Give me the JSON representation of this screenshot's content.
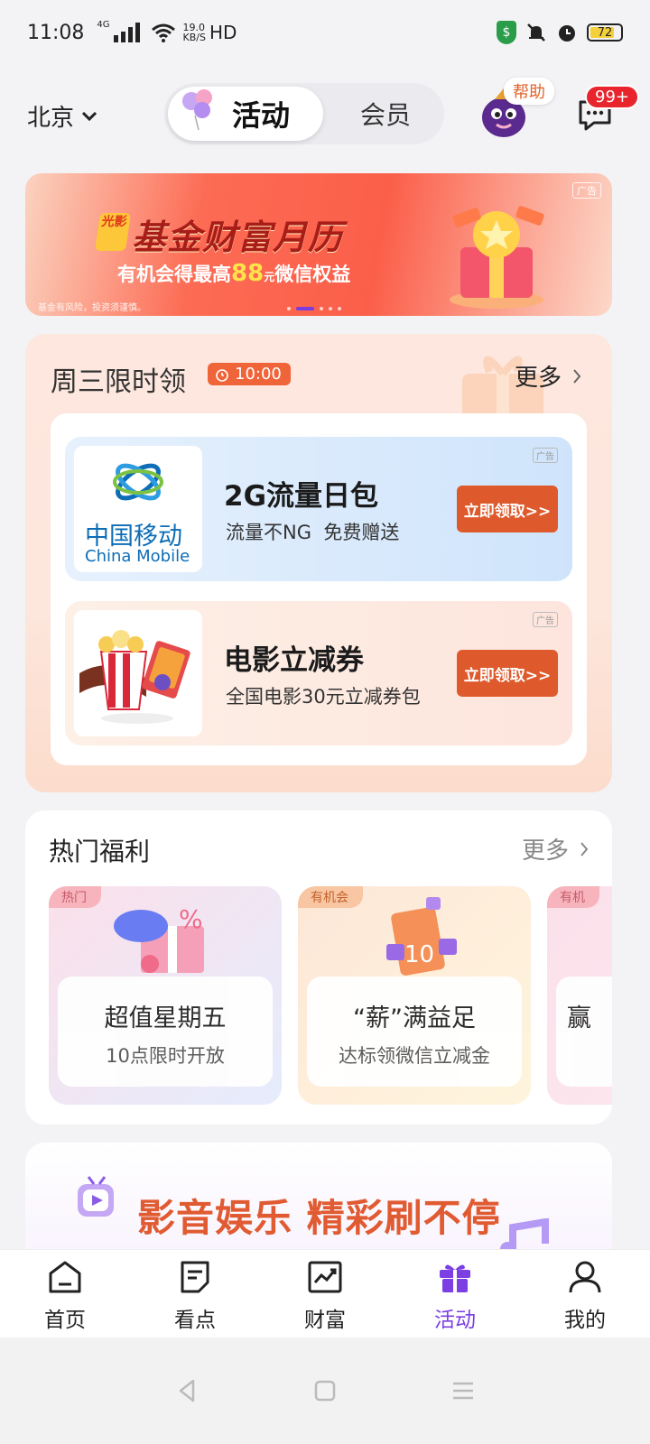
{
  "status": {
    "time": "11:08",
    "network": "4G",
    "speed_value": "19.0",
    "speed_unit": "KB/S",
    "hd": "HD",
    "battery": "72"
  },
  "header": {
    "city": "北京",
    "tabs": [
      {
        "label": "活动",
        "active": true
      },
      {
        "label": "会员",
        "active": false
      }
    ],
    "help_label": "帮助",
    "message_badge": "99+"
  },
  "banner": {
    "logo_text": "光影",
    "title": "基金财富月历",
    "subtitle_pre": "有机会得最高",
    "subtitle_num": "88",
    "subtitle_unit": "元",
    "subtitle_post": "微信权益",
    "ad_tag": "广告",
    "fine_print": "基金有风险，投资须谨慎。"
  },
  "wednesday": {
    "title": "周三限时领",
    "timer": "10:00",
    "more_label": "更多",
    "cards": [
      {
        "brand_cn": "中国移动",
        "brand_en": "China Mobile",
        "name": "2G流量日包",
        "desc": "流量不NG  免费赠送",
        "button": "立即领取>>",
        "ad_tag": "广告"
      },
      {
        "name": "电影立减券",
        "desc": "全国电影30元立减券包",
        "button": "立即领取>>",
        "ad_tag": "广告"
      }
    ]
  },
  "hot": {
    "title": "热门福利",
    "more_label": "更多",
    "cards": [
      {
        "ribbon": "热门",
        "title": "超值星期五",
        "sub": "10点限时开放"
      },
      {
        "ribbon": "有机会",
        "title": "“薪”满益足",
        "sub": "达标领微信立减金"
      },
      {
        "ribbon": "有机",
        "title": "赢",
        "sub": ""
      }
    ]
  },
  "entertainment": {
    "title": "影音娱乐 精彩刷不停"
  },
  "nav": {
    "items": [
      {
        "label": "首页"
      },
      {
        "label": "看点"
      },
      {
        "label": "财富"
      },
      {
        "label": "活动"
      },
      {
        "label": "我的"
      }
    ]
  },
  "colors": {
    "accent": "#7b3fe4",
    "button": "#de5a2c",
    "badge": "#e8242d"
  }
}
